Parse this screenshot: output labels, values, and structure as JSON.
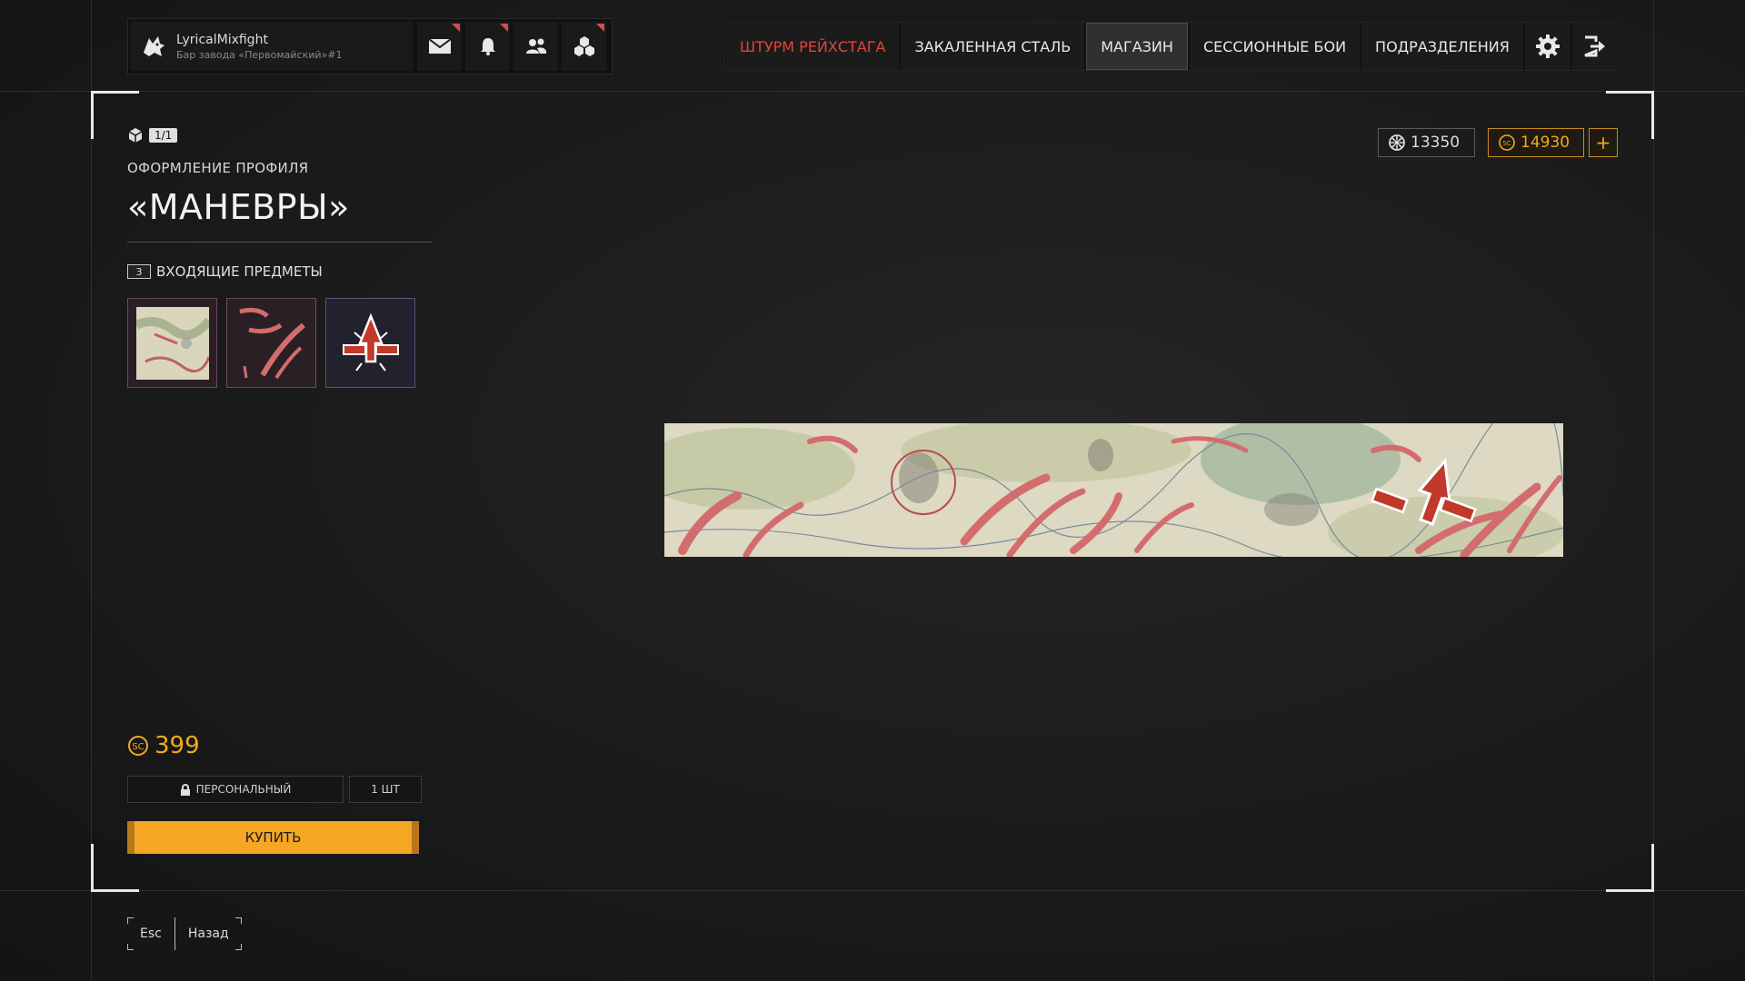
{
  "profile": {
    "name": "LyricalMixfight",
    "subtitle": "Бар завода «Первомайский»#1",
    "icons": [
      "mail-icon",
      "bell-icon",
      "friends-icon",
      "clan-icon"
    ]
  },
  "nav": {
    "items": [
      {
        "label": "ШТУРМ РЕЙХСТАГА",
        "color": "#e0453c"
      },
      {
        "label": "ЗАКАЛЕННАЯ СТАЛЬ"
      },
      {
        "label": "МАГАЗИН",
        "active": true
      },
      {
        "label": "СЕССИОННЫЕ БОИ"
      },
      {
        "label": "ПОДРАЗДЕЛЕНИЯ"
      }
    ],
    "settings_icon": "gear-icon",
    "exit_icon": "logout-icon"
  },
  "item": {
    "count": "1/1",
    "category": "ОФОРМЛЕНИЕ ПРОФИЛЯ",
    "title": "«МАНЕВРЫ»",
    "included_label": "ВХОДЯЩИЕ ПРЕДМЕТЫ",
    "included_count": "3",
    "price": "399",
    "type_label": "ПЕРСОНАЛЬНЫЙ",
    "qty_label": "1 ШТ",
    "buy_label": "КУПИТЬ"
  },
  "currency": {
    "silver": "13350",
    "gold": "14930",
    "plus": "+"
  },
  "footer": {
    "key": "Esc",
    "label": "Назад"
  },
  "colors": {
    "accent": "#f5a623",
    "red": "#e0453c"
  }
}
